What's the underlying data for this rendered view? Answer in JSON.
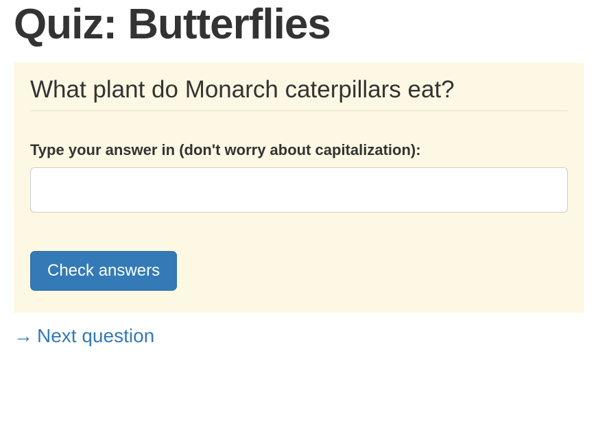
{
  "title": "Quiz: Butterflies",
  "question": {
    "prompt": "What plant do Monarch caterpillars eat?",
    "input_label": "Type your answer in (don't worry about capitalization):",
    "input_value": ""
  },
  "buttons": {
    "check_label": "Check answers"
  },
  "nav": {
    "next_arrow": "→",
    "next_label": "Next question"
  }
}
